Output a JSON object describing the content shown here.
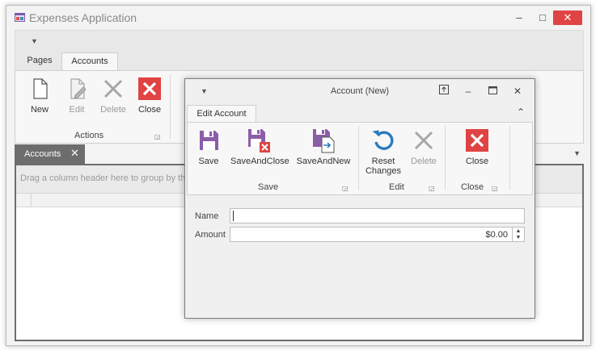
{
  "app": {
    "title": "Expenses Application"
  },
  "window_controls": {
    "minimize": "–",
    "maximize": "□",
    "close": "✕"
  },
  "ribbon": {
    "tabs": [
      "Pages",
      "Accounts"
    ],
    "active_tab": "Accounts",
    "items": [
      {
        "label": "New",
        "icon": "new-document-icon",
        "enabled": true
      },
      {
        "label": "Edit",
        "icon": "edit-document-icon",
        "enabled": false
      },
      {
        "label": "Delete",
        "icon": "delete-x-icon",
        "enabled": false
      },
      {
        "label": "Close",
        "icon": "close-red-icon",
        "enabled": true
      }
    ],
    "group_label": "Actions"
  },
  "documents": {
    "tab_label": "Accounts",
    "tab_close": "✕",
    "group_panel_text": "Drag a column header here to group by that column"
  },
  "dialog": {
    "title": "Account (New)",
    "tab": "Edit Account",
    "items": [
      {
        "label": "Save",
        "icon": "save-icon",
        "enabled": true
      },
      {
        "label": "SaveAndClose",
        "icon": "save-and-close-icon",
        "enabled": true
      },
      {
        "label": "SaveAndNew",
        "icon": "save-and-new-icon",
        "enabled": true
      },
      {
        "label": "Reset Changes",
        "icon": "reset-changes-icon",
        "enabled": true
      },
      {
        "label": "Delete",
        "icon": "delete-x-icon",
        "enabled": false
      },
      {
        "label": "Close",
        "icon": "close-red-icon",
        "enabled": true
      }
    ],
    "groups": [
      "Save",
      "Edit",
      "Close"
    ],
    "form": {
      "name_label": "Name",
      "name_value": "",
      "amount_label": "Amount",
      "amount_value": "$0.00"
    }
  },
  "colors": {
    "accent_purple": "#8b5ea8",
    "close_red": "#e04343",
    "reset_blue": "#2b7bbf",
    "disabled_gray": "#a6a6a6",
    "doc_tab": "#6d6d6d"
  }
}
